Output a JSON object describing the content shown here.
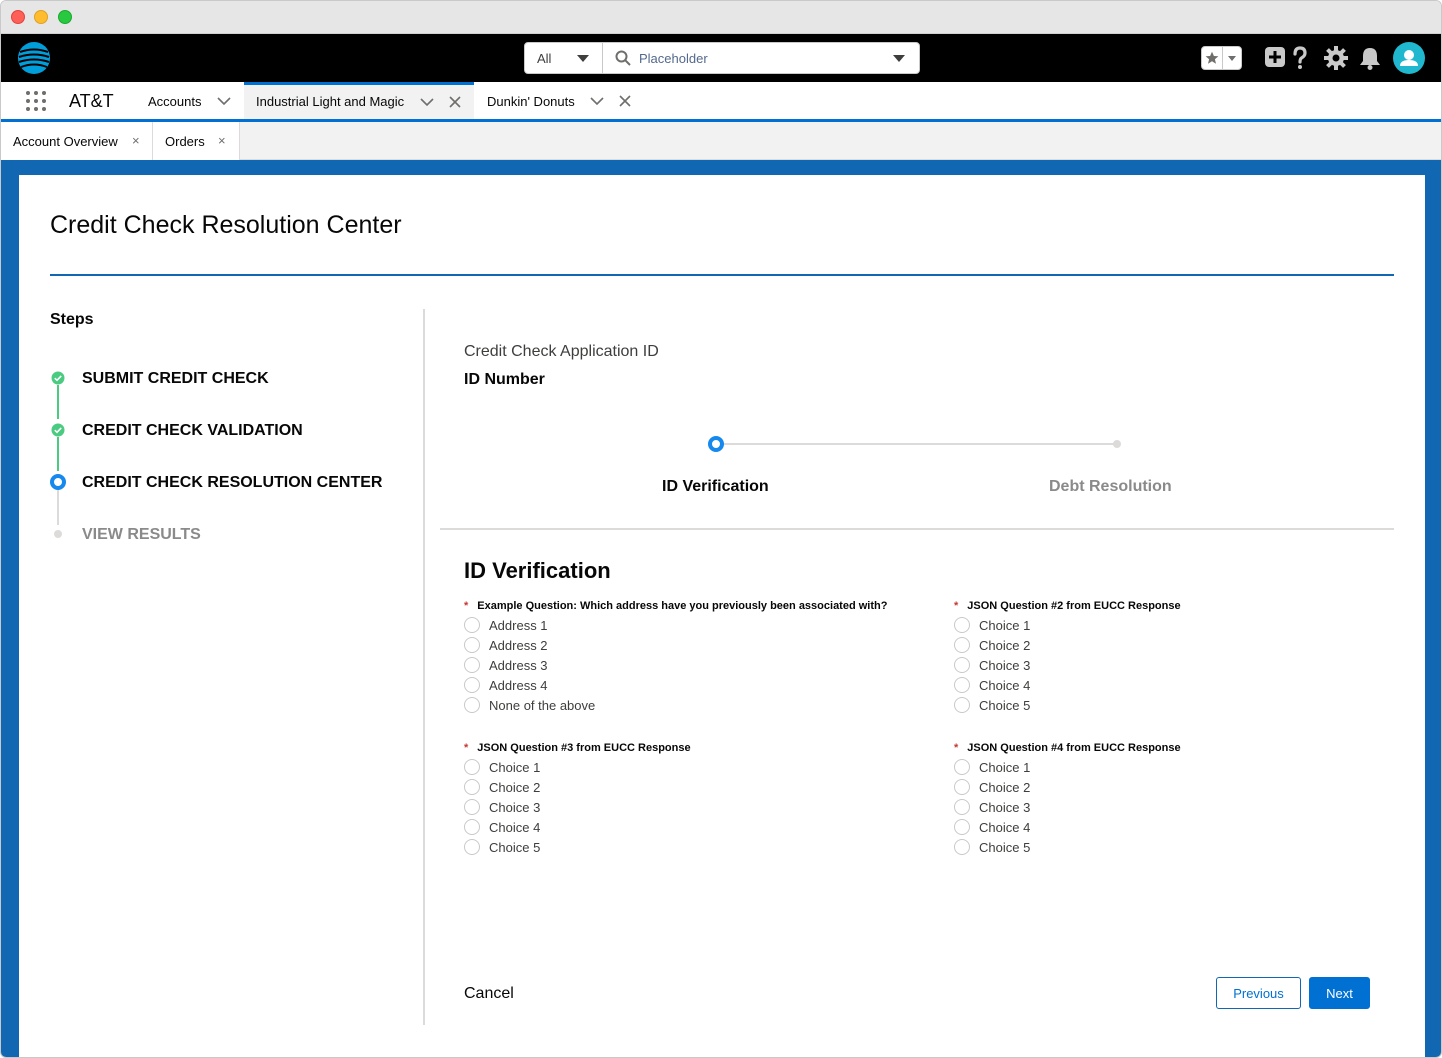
{
  "global_header": {
    "search_scope": "All",
    "search_placeholder": "Placeholder"
  },
  "nav": {
    "app_name": "AT&T",
    "items": [
      {
        "label": "Accounts"
      },
      {
        "label": "Industrial Light and Magic",
        "active": true
      },
      {
        "label": "Dunkin' Donuts"
      }
    ]
  },
  "subtabs": [
    {
      "label": "Account Overview",
      "close": "×"
    },
    {
      "label": "Orders",
      "close": "×"
    }
  ],
  "page": {
    "title": "Credit Check Resolution Center"
  },
  "steps": {
    "heading": "Steps",
    "items": [
      {
        "label": "SUBMIT CREDIT CHECK",
        "status": "complete"
      },
      {
        "label": "CREDIT CHECK VALIDATION",
        "status": "complete"
      },
      {
        "label": "CREDIT CHECK RESOLUTION CENTER",
        "status": "active"
      },
      {
        "label": "VIEW RESULTS",
        "status": "pending"
      }
    ]
  },
  "application": {
    "label": "Credit Check Application ID",
    "value": "ID Number"
  },
  "progress": {
    "steps": [
      {
        "label": "ID Verification",
        "status": "active"
      },
      {
        "label": "Debt Resolution",
        "status": "pending"
      }
    ]
  },
  "section": {
    "title": "ID Verification",
    "questions": [
      {
        "required": "*",
        "label": "Example Question: Which address have you previously been associated with?",
        "options": [
          "Address 1",
          "Address 2",
          "Address 3",
          "Address 4",
          "None of the above"
        ]
      },
      {
        "required": "*",
        "label": "JSON Question #2 from EUCC Response",
        "options": [
          "Choice 1",
          "Choice 2",
          "Choice 3",
          "Choice 4",
          "Choice 5"
        ]
      },
      {
        "required": "*",
        "label": "JSON Question #3 from EUCC Response",
        "options": [
          "Choice 1",
          "Choice 2",
          "Choice 3",
          "Choice 4",
          "Choice 5"
        ]
      },
      {
        "required": "*",
        "label": "JSON Question #4 from EUCC Response",
        "options": [
          "Choice 1",
          "Choice 2",
          "Choice 3",
          "Choice 4",
          "Choice 5"
        ]
      }
    ]
  },
  "footer": {
    "cancel_label": "Cancel",
    "previous_label": "Previous",
    "next_label": "Next"
  },
  "colors": {
    "brand_blue": "#0070d2",
    "frame_blue": "#1167b1",
    "success_green": "#4bca81",
    "required_red": "#c23934"
  }
}
